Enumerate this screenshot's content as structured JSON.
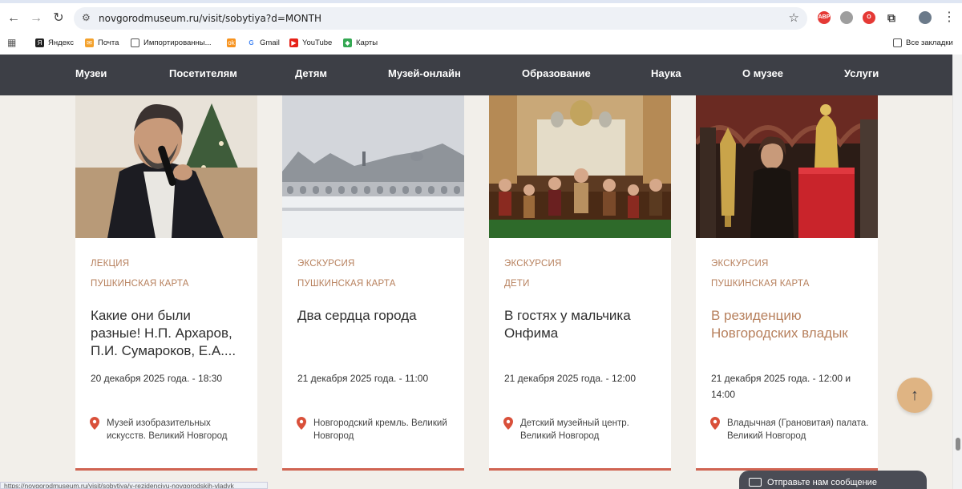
{
  "browser": {
    "url": "novgorodmuseum.ru/visit/sobytiya?d=MONTH",
    "bookmarks": [
      {
        "label": "Яндекс",
        "icon": "yandex-icon"
      },
      {
        "label": "Почта",
        "icon": "mail-icon"
      },
      {
        "label": "Импортированны...",
        "icon": "folder-icon"
      },
      {
        "label": "",
        "icon": "ok-icon"
      },
      {
        "label": "Gmail",
        "icon": "google-icon"
      },
      {
        "label": "YouTube",
        "icon": "youtube-icon"
      },
      {
        "label": "Карты",
        "icon": "maps-icon"
      }
    ],
    "all_bookmarks": "Все закладки",
    "status_url": "https://novgorodmuseum.ru/visit/sobytiya/v-rezidenciyu-novgorodskih-vladyk"
  },
  "nav": {
    "items": [
      "Музеи",
      "Посетителям",
      "Детям",
      "Музей-онлайн",
      "Образование",
      "Наука",
      "О музее",
      "Услуги"
    ]
  },
  "cards": [
    {
      "tag1": "ЛЕКЦИЯ",
      "tag2": "ПУШКИНСКАЯ КАРТА",
      "title": "Какие они были разные! Н.П. Архаров, П.И. Сумароков, Е.А....",
      "date": "20 декабря 2025 года. - 18:30",
      "place": "Музей изобразительных искусств. Великий Новгород",
      "image": "lecturer-photo"
    },
    {
      "tag1": "ЭКСКУРСИЯ",
      "tag2": "ПУШКИНСКАЯ КАРТА",
      "title": "Два сердца города",
      "date": "21 декабря 2025 года. - 11:00",
      "place": "Новгородский кремль. Великий Новгород",
      "image": "winter-kremlin-photo"
    },
    {
      "tag1": "ЭКСКУРСИЯ",
      "tag2": "ДЕТИ",
      "title": "В гостях у мальчика Онфима",
      "date": "21 декабря 2025 года. - 12:00",
      "place": "Детский музейный центр. Великий Новгород",
      "image": "puppets-photo"
    },
    {
      "tag1": "ЭКСКУРСИЯ",
      "tag2": "ПУШКИНСКАЯ КАРТА",
      "title": "В резиденцию Новгородских владык",
      "date": "21 декабря 2025 года. - 12:00 и 14:00",
      "place": "Владычная (Грановитая) палата. Великий Новгород",
      "image": "treasury-photo"
    }
  ],
  "message_button": "Отправьте нам сообщение",
  "colors": {
    "nav_bg": "#3d3f46",
    "accent_tag": "#b7805d",
    "card_border": "#d06452",
    "up_button": "#dfb483",
    "page_bg": "#f2efea"
  }
}
